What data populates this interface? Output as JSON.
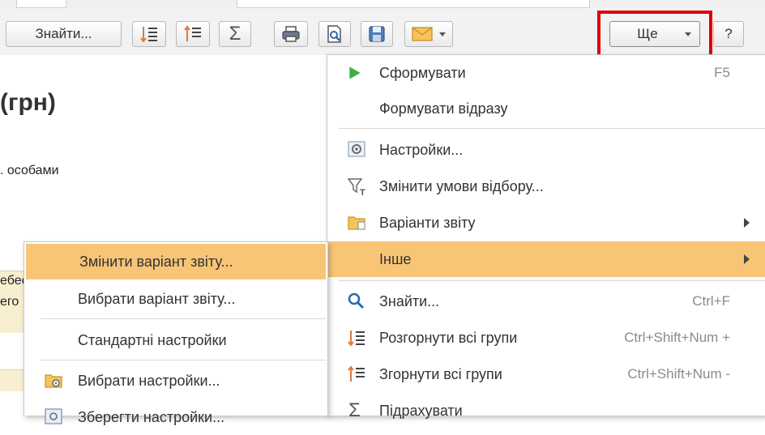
{
  "toolbar": {
    "find_label": "Знайти...",
    "more_label": "Ще",
    "help_label": "?"
  },
  "document": {
    "title_fragment": "(грн)",
    "line_fragment": ". особами",
    "row1_fragment": "ебес",
    "row2_fragment": "его"
  },
  "main_menu": {
    "items": [
      {
        "label": "Сформувати",
        "shortcut": "F5",
        "icon": "play-icon"
      },
      {
        "label": "Формувати відразу",
        "shortcut": "",
        "icon": ""
      },
      {
        "label": "Настройки...",
        "shortcut": "",
        "icon": "settings-icon"
      },
      {
        "label": "Змінити умови відбору...",
        "shortcut": "",
        "icon": "filter-icon"
      },
      {
        "label": "Варіанти звіту",
        "shortcut": "",
        "icon": "folder-icon",
        "submenu": true
      },
      {
        "label": "Інше",
        "shortcut": "",
        "icon": "",
        "submenu": true,
        "highlighted": true
      },
      {
        "label": "Знайти...",
        "shortcut": "Ctrl+F",
        "icon": "search-icon"
      },
      {
        "label": "Розгорнути всі групи",
        "shortcut": "Ctrl+Shift+Num +",
        "icon": "expand-groups-icon"
      },
      {
        "label": "Згорнути всі групи",
        "shortcut": "Ctrl+Shift+Num -",
        "icon": "collapse-groups-icon"
      },
      {
        "label": "Підрахувати",
        "shortcut": "",
        "icon": "sigma-icon"
      }
    ]
  },
  "sub_menu": {
    "items": [
      {
        "label": "Змінити варіант звіту...",
        "highlighted": true
      },
      {
        "label": "Вибрати варіант звіту..."
      },
      {
        "label": "Стандартні настройки"
      },
      {
        "label": "Вибрати настройки...",
        "icon": "settings-folder-icon"
      },
      {
        "label": "Зберегти настройки...",
        "icon": "save-settings-icon"
      }
    ]
  },
  "colors": {
    "highlight": "#f8c476",
    "accent_red": "#e00000",
    "play_green": "#3cb043",
    "icon_blue": "#2a6bb0",
    "icon_orange": "#e07a3a"
  }
}
